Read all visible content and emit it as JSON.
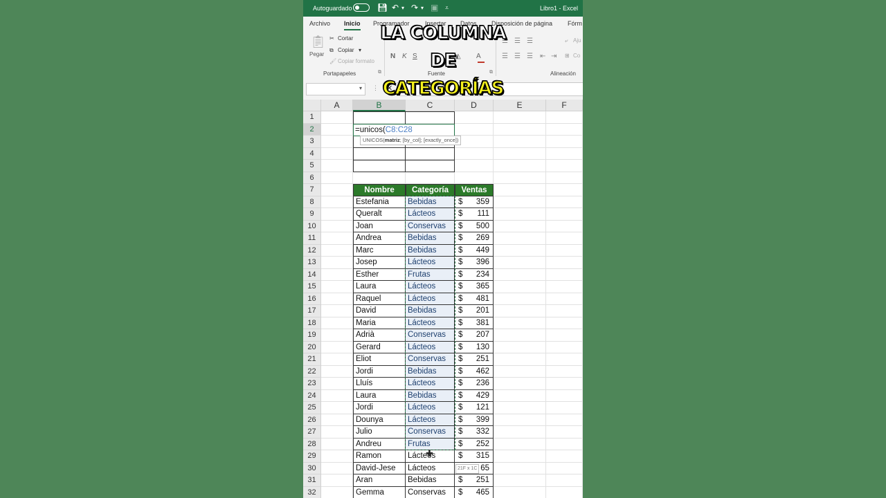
{
  "titlebar": {
    "autosave_label": "Autoguardado",
    "doc_title": "Libro1  -  Excel"
  },
  "ribbon": {
    "tabs": [
      "Archivo",
      "Inicio",
      "Programador",
      "Insertar",
      "Datos",
      "Disposición de página",
      "Fórm"
    ],
    "active_tab": "Inicio",
    "clipboard": {
      "paste": "Pegar",
      "cut": "Cortar",
      "copy": "Copiar",
      "format_painter": "Copiar formato",
      "group": "Portapapeles"
    },
    "font": {
      "bold": "N",
      "italic": "K",
      "underline": "S",
      "group": "Fuente"
    },
    "alignment": {
      "group": "Alineación",
      "wrap": "Aju",
      "merge": "Co"
    }
  },
  "formula_bar": {
    "namebox": "",
    "fx_cancel": "✕"
  },
  "grid": {
    "columns": [
      "A",
      "B",
      "C",
      "D",
      "E",
      "F"
    ],
    "rows": [
      "1",
      "2",
      "3",
      "4",
      "5",
      "6",
      "7",
      "8",
      "9",
      "10",
      "11",
      "12",
      "13",
      "14",
      "15",
      "16",
      "17",
      "18",
      "19",
      "20",
      "21",
      "22",
      "23",
      "24",
      "25",
      "26",
      "27",
      "28",
      "29",
      "30",
      "31",
      "32"
    ],
    "active_cell_prefix": "=unicos(",
    "active_cell_ref": "C8:C28",
    "tooltip": {
      "func": "UNICOS(",
      "arg1": "matriz",
      "rest": "; [by_col]; [exactly_once])"
    },
    "size_hint": "21F x 1C"
  },
  "table": {
    "headers": [
      "Nombre",
      "Categoría",
      "Ventas"
    ],
    "currency": "$",
    "rows": [
      [
        "Estefania",
        "Bebidas",
        "359"
      ],
      [
        "Queralt",
        "Lácteos",
        "111"
      ],
      [
        "Joan",
        "Conservas",
        "500"
      ],
      [
        "Andrea",
        "Bebidas",
        "269"
      ],
      [
        "Marc",
        "Bebidas",
        "449"
      ],
      [
        "Josep",
        "Lácteos",
        "396"
      ],
      [
        "Esther",
        "Frutas",
        "234"
      ],
      [
        "Laura",
        "Lácteos",
        "365"
      ],
      [
        "Raquel",
        "Lácteos",
        "481"
      ],
      [
        "David",
        "Bebidas",
        "201"
      ],
      [
        "Maria",
        "Lácteos",
        "381"
      ],
      [
        "Adrià",
        "Conservas",
        "207"
      ],
      [
        "Gerard",
        "Lácteos",
        "130"
      ],
      [
        "Eliot",
        "Conservas",
        "251"
      ],
      [
        "Jordi",
        "Bebidas",
        "462"
      ],
      [
        "Lluís",
        "Lácteos",
        "236"
      ],
      [
        "Laura",
        "Bebidas",
        "429"
      ],
      [
        "Jordi",
        "Lácteos",
        "121"
      ],
      [
        "Dounya",
        "Lácteos",
        "399"
      ],
      [
        "Julio",
        "Conservas",
        "332"
      ],
      [
        "Andreu",
        "Frutas",
        "252"
      ],
      [
        "Ramon",
        "Lácteos",
        "315"
      ],
      [
        "David-Jese",
        "Lácteos",
        "65"
      ],
      [
        "Aran",
        "Bebidas",
        "251"
      ],
      [
        "Gemma",
        "Conservas",
        "465"
      ]
    ]
  },
  "caption": {
    "line1": "LA COLUMNA",
    "line2": "DE",
    "line3": "CATEGORÍAS"
  },
  "colors": {
    "excel_green": "#217346",
    "header_green": "#2c7a2a",
    "background": "#4e8658",
    "caption_line1": "#ffffff",
    "caption_line2": "#ffffff",
    "caption_line3": "#f6f21d"
  }
}
